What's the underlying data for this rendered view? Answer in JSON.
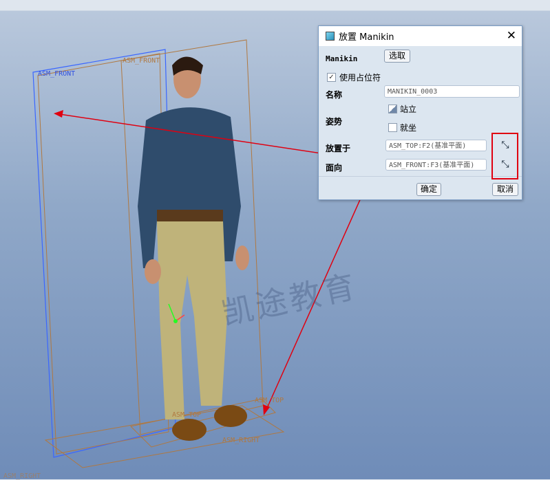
{
  "viewport": {
    "planes": [
      "ASM_FRONT",
      "ASM_FRONT",
      "ASM_TOP",
      "ASM_TOP",
      "ASM_RIGHT",
      "ASM_RIGHT"
    ]
  },
  "watermark": "凯途教育",
  "dialog": {
    "title": "放置 Manikin",
    "manikin_label": "Manikin",
    "select_button": "选取",
    "use_placeholder_label": "使用占位符",
    "use_placeholder_checked": true,
    "name_label": "名称",
    "name_value": "MANIKIN_0003",
    "posture_label": "姿势",
    "posture_options": [
      "站立",
      "就坐"
    ],
    "posture_selected": "站立",
    "place_on_label": "放置于",
    "place_on_value": "ASM_TOP:F2(基准平面)",
    "facing_label": "面向",
    "facing_value": "ASM_FRONT:F3(基准平面)",
    "ok_button": "确定",
    "cancel_button": "取消"
  },
  "colors": {
    "annotation": "#e00010",
    "plane": "#b07840",
    "plane_selected": "#3050e0"
  }
}
